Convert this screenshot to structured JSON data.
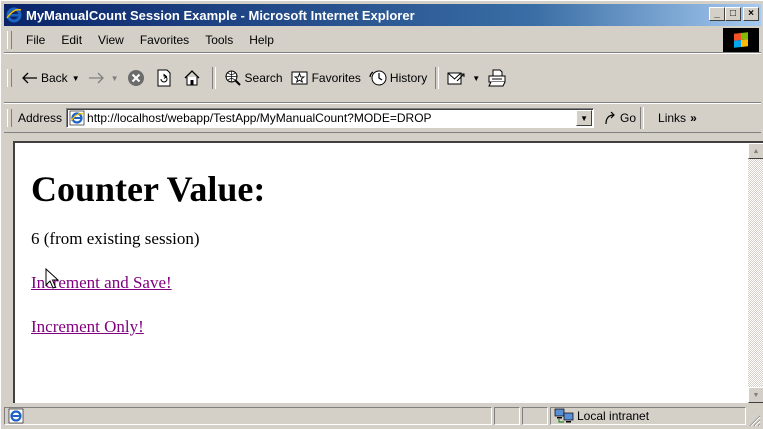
{
  "window": {
    "title": "MyManualCount Session Example - Microsoft Internet Explorer",
    "minimize_glyph": "_",
    "maximize_glyph": "□",
    "close_glyph": "×"
  },
  "menu": {
    "items": [
      "File",
      "Edit",
      "View",
      "Favorites",
      "Tools",
      "Help"
    ]
  },
  "toolbar": {
    "back": "Back",
    "search": "Search",
    "favorites": "Favorites",
    "history": "History"
  },
  "address": {
    "label": "Address",
    "url": "http://localhost/webapp/TestApp/MyManualCount?MODE=DROP",
    "go": "Go",
    "links": "Links",
    "links_more": "»"
  },
  "page": {
    "heading": "Counter Value:",
    "count_text": "6 (from existing session)",
    "link_save": "Increment and Save!",
    "link_only": "Increment Only!",
    "link_color": "#800080"
  },
  "status": {
    "zone": "Local intranet"
  }
}
